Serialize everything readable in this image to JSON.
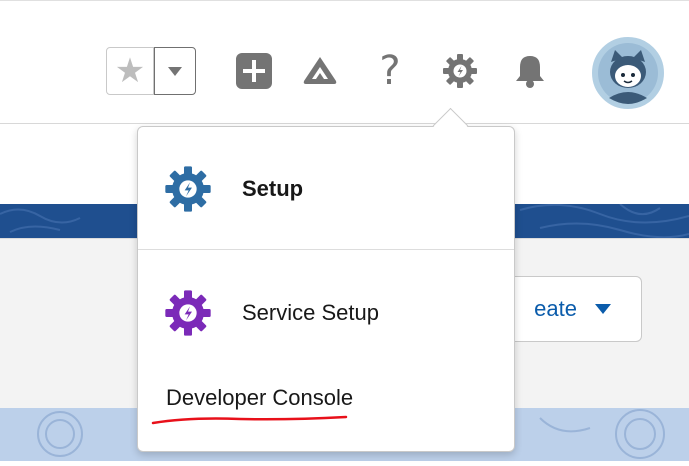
{
  "header": {
    "favorites_icon": "star-icon",
    "favorites_menu_icon": "chevron-down-icon",
    "global_actions_icon": "plus-icon",
    "trailhead_icon": "trailhead-icon",
    "help_label": "?",
    "setup_icon": "gear-icon",
    "notifications_icon": "bell-icon",
    "avatar_icon": "user-avatar-icon"
  },
  "background": {
    "create_button_label": "eate"
  },
  "setup_menu": {
    "items": [
      {
        "label": "Setup",
        "icon": "setup-gear-icon",
        "color": "#2e6da4"
      },
      {
        "label": "Service Setup",
        "icon": "service-setup-gear-icon",
        "color": "#7b2ab8"
      }
    ],
    "developer_console_label": "Developer Console"
  },
  "colors": {
    "icon_gray": "#747474",
    "banner_blue": "#1f4f8f",
    "link_blue": "#0b5cab",
    "annotation_red": "#e8101a"
  }
}
